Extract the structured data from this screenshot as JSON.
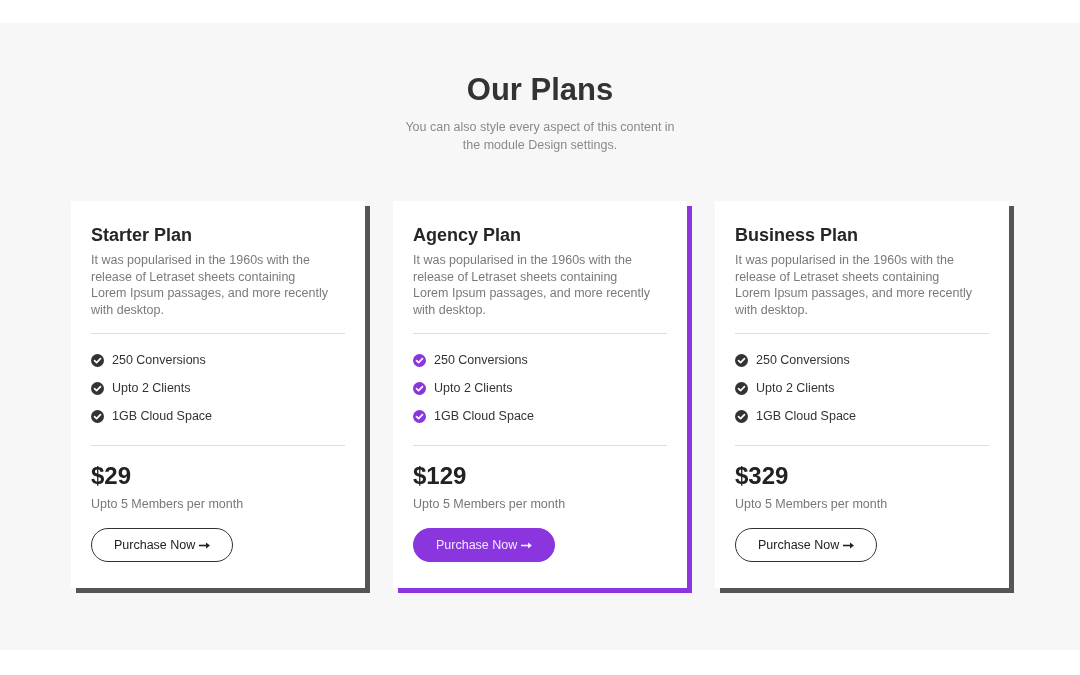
{
  "section": {
    "title": "Our Plans",
    "subtitle": "You can also style every aspect of this content in the module Design settings."
  },
  "plans": [
    {
      "name": "Starter Plan",
      "description": "It was popularised in the 1960s with the release of Letraset sheets containing Lorem Ipsum passages, and more recently with desktop.",
      "features": [
        "250 Conversions",
        "Upto 2 Clients",
        "1GB Cloud Space"
      ],
      "price": "$29",
      "price_note": "Upto 5 Members per month",
      "button": "Purchase Now",
      "featured": false
    },
    {
      "name": "Agency Plan",
      "description": "It was popularised in the 1960s with the release of Letraset sheets containing Lorem Ipsum passages, and more recently with desktop.",
      "features": [
        "250 Conversions",
        "Upto 2 Clients",
        "1GB Cloud Space"
      ],
      "price": "$129",
      "price_note": "Upto 5 Members per month",
      "button": "Purchase Now",
      "featured": true
    },
    {
      "name": "Business Plan",
      "description": "It was popularised in the 1960s with the release of Letraset sheets containing Lorem Ipsum passages, and more recently with desktop.",
      "features": [
        "250 Conversions",
        "Upto 2 Clients",
        "1GB Cloud Space"
      ],
      "price": "$329",
      "price_note": "Upto 5 Members per month",
      "button": "Purchase Now",
      "featured": false
    }
  ]
}
